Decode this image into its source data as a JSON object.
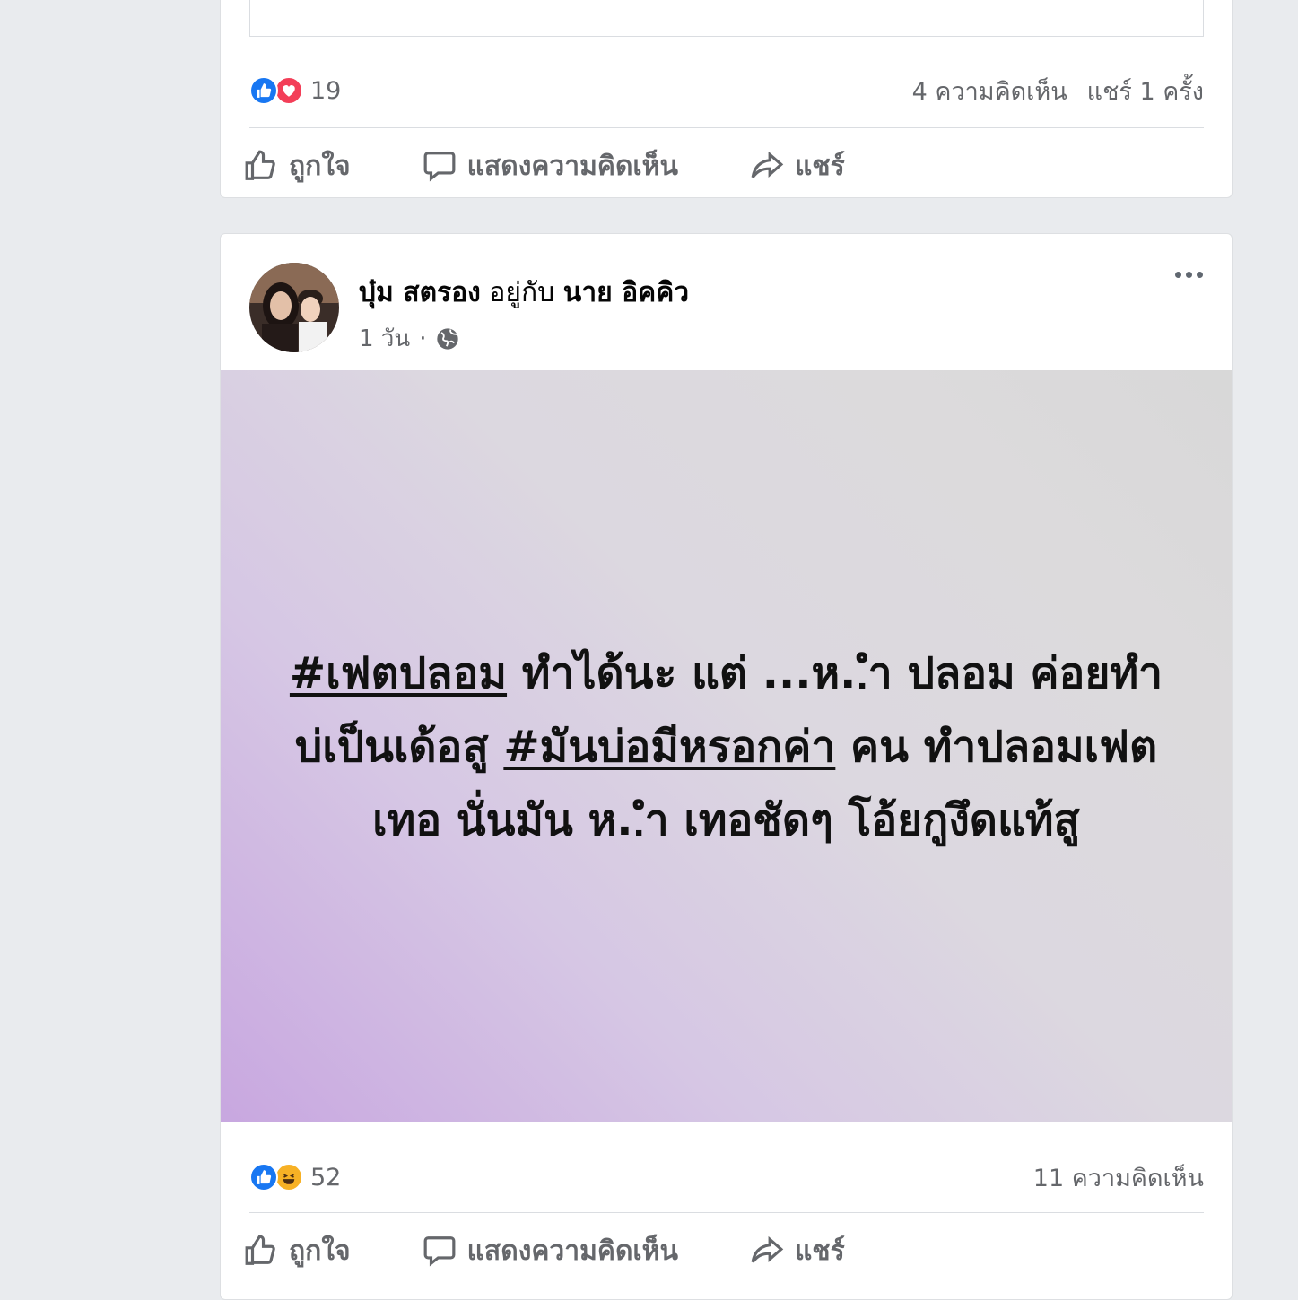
{
  "previous_post": {
    "reaction_count": "19",
    "comments": "4 ความคิดเห็น",
    "shares": "แชร์ 1 ครั้ง",
    "actions": {
      "like": "ถูกใจ",
      "comment": "แสดงความคิดเห็น",
      "share": "แชร์"
    }
  },
  "post": {
    "author": "บุ๋ม สตรอง",
    "with_text": "อยู่กับ",
    "tagged": "นาย อิคคิว",
    "time": "1 วัน",
    "dot": "·",
    "privacy_icon": "globe-icon",
    "text": {
      "hashtag1": "#เฟตปลอม",
      "part1": " ทำได้นะ แต่ ...ห..ํา ปลอม ค่อยทำบ่เป็นเด้อสู ",
      "hashtag2": "#มันบ่อมีหรอกค่า",
      "part2": " คน ทำปลอมเฟต เทอ นั่นมัน ห..ํา เทอชัดๆ โอ้ยกูงึดแท้สู"
    },
    "background_colors": [
      "#c8a7e0",
      "#d8d8d8"
    ],
    "reaction_count": "52",
    "comments": "11 ความคิดเห็น",
    "actions": {
      "like": "ถูกใจ",
      "comment": "แสดงความคิดเห็น",
      "share": "แชร์"
    }
  },
  "colors": {
    "like": "#1877f2",
    "love": "#f33e58",
    "haha": "#f7b125",
    "text_secondary": "#65676b"
  }
}
